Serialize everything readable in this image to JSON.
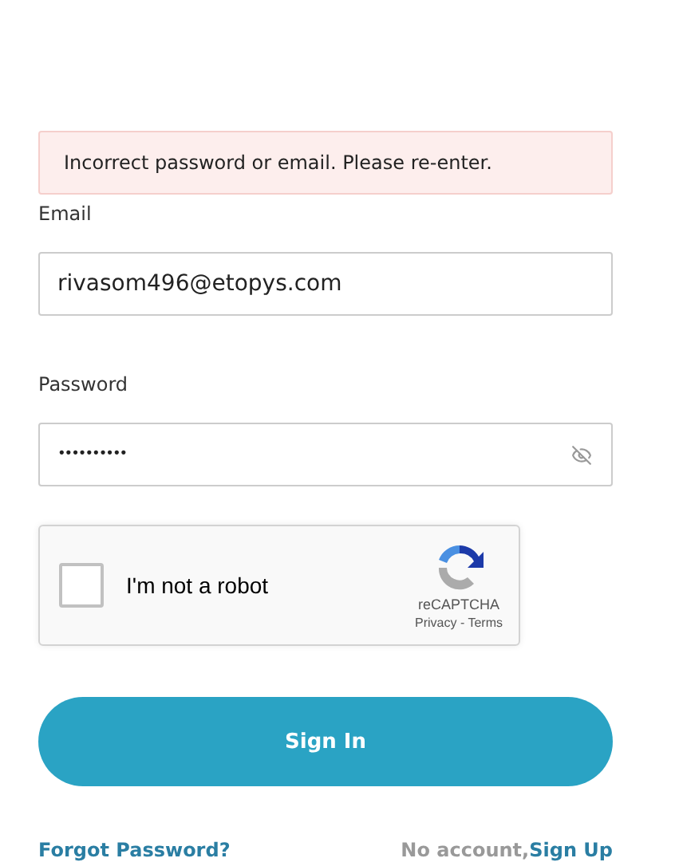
{
  "error": "Incorrect password or email. Please re-enter.",
  "email": {
    "label": "Email",
    "value": "rivasom496@etopys.com"
  },
  "password": {
    "label": "Password",
    "value": "••••••••••",
    "visible": false
  },
  "captcha": {
    "label": "I'm not a robot",
    "checked": false,
    "brand": "reCAPTCHA",
    "privacy": "Privacy",
    "separator": " - ",
    "terms": "Terms"
  },
  "submit": "Sign In",
  "forgot": "Forgot Password?",
  "signup": {
    "prompt": "No account,",
    "link": "Sign Up"
  }
}
